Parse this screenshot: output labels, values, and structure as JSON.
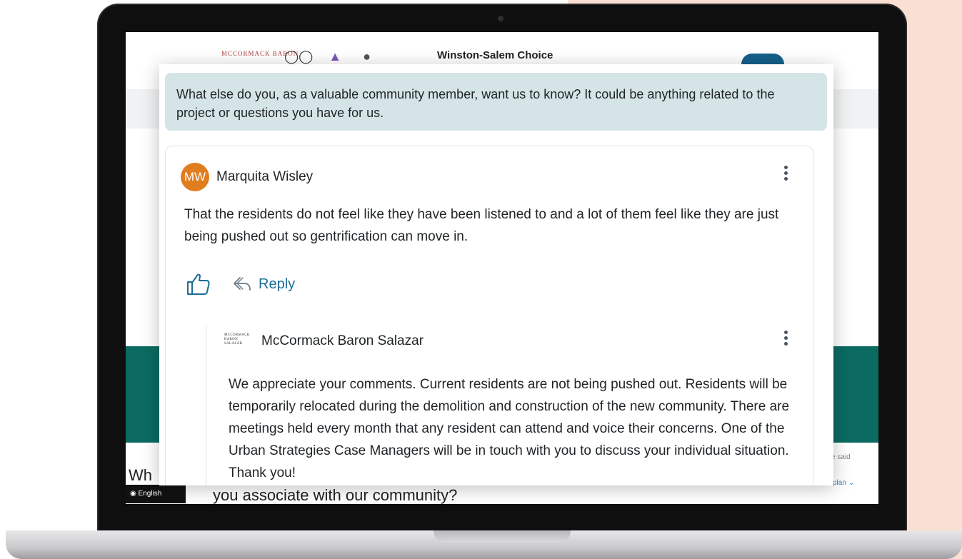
{
  "site": {
    "title": "Winston-Salem Choice",
    "logo_text": "MCCORMACK BARON",
    "partial_heading": "Wh",
    "language": "English",
    "bottom_question": "you associate with our community?",
    "side_said": "e said",
    "side_link": "plan"
  },
  "question": {
    "text": "What else do you, as a valuable community member, want us to know? It could be anything related to the project or questions you have for us."
  },
  "comment": {
    "initials": "MW",
    "avatar_color": "#e07e1f",
    "author": "Marquita Wisley",
    "text": "That the residents do not feel like they have been listened to and a lot of them feel like they are just being pushed out so gentrification can move in.",
    "reply_label": "Reply",
    "accent_color": "#1c6c97"
  },
  "reply": {
    "logo_text": "MCCORMACK BARON SALAZAR",
    "author": "McCormack Baron Salazar",
    "text": "We appreciate your comments. Current residents are not being pushed out. Residents will be temporarily relocated during the demolition and construction of the new community. There are meetings held every month that any resident can attend and voice their concerns. One of the Urban Strategies Case Managers will be in touch with you to discuss your individual situation. Thank you!"
  },
  "colors": {
    "background_peach": "#f9e0d2",
    "question_bg": "#d5e5e7",
    "teal_band": "#0b6b62"
  }
}
